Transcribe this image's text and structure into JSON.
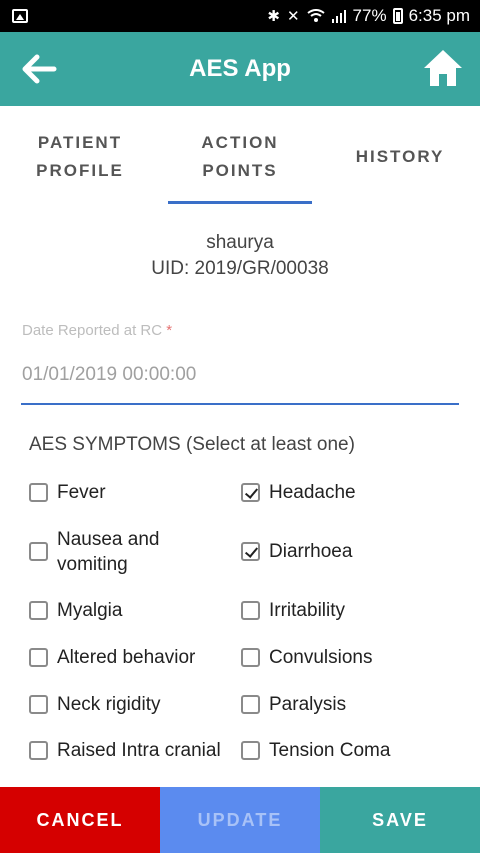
{
  "status_bar": {
    "battery": "77%",
    "time": "6:35 pm",
    "icons": [
      "image-icon",
      "bluetooth-icon",
      "mute-icon",
      "wifi-icon",
      "signal-icon",
      "battery-icon"
    ]
  },
  "app_bar": {
    "title": "AES App",
    "back_icon": "arrow-left-icon",
    "home_icon": "home-icon",
    "color": "#3aa69f"
  },
  "tabs": [
    {
      "line1": "PATIENT",
      "line2": "PROFILE",
      "active": false
    },
    {
      "line1": "ACTION",
      "line2": "POINTS",
      "active": true
    },
    {
      "line1": "HISTORY",
      "line2": "",
      "active": false
    }
  ],
  "patient": {
    "name": "shaurya",
    "uid": "UID: 2019/GR/00038"
  },
  "date_field": {
    "label": "Date Reported at RC",
    "required_mark": "*",
    "value": "01/01/2019 00:00:00"
  },
  "symptoms": {
    "title": "AES SYMPTOMS (Select at least one)",
    "left": [
      {
        "label": "Fever",
        "checked": false
      },
      {
        "label": "Nausea and vomiting",
        "line1": "Nausea and",
        "line2": "vomiting",
        "checked": false
      },
      {
        "label": "Myalgia",
        "checked": false
      },
      {
        "label": "Altered behavior",
        "checked": false
      },
      {
        "label": "Neck rigidity",
        "checked": false
      },
      {
        "label": "Raised Intra cranial",
        "checked": false
      }
    ],
    "right": [
      {
        "label": "Headache",
        "checked": true
      },
      {
        "label": "Diarrhoea",
        "checked": true
      },
      {
        "label": "Irritability",
        "checked": false
      },
      {
        "label": "Convulsions",
        "checked": false
      },
      {
        "label": "Paralysis",
        "checked": false
      },
      {
        "label": "Tension Coma",
        "checked": false
      }
    ]
  },
  "bottom_bar": {
    "cancel": "CANCEL",
    "update": "UPDATE",
    "save": "SAVE",
    "colors": {
      "cancel": "#d50000",
      "update": "#5b8bef",
      "save": "#3aa69f"
    }
  }
}
